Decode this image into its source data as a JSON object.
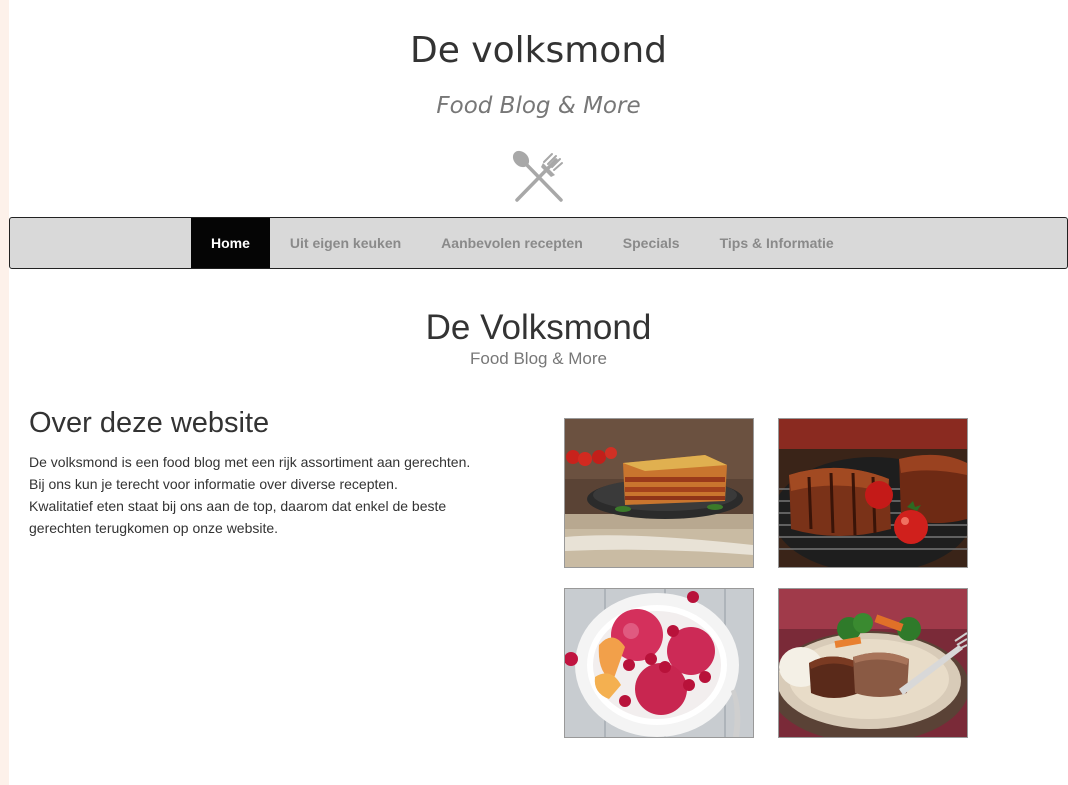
{
  "header": {
    "site_title": "De volksmond",
    "tagline": "Food Blog & More",
    "logo_icon": "cutlery-icon"
  },
  "nav": {
    "items": [
      {
        "label": "Home",
        "active": true
      },
      {
        "label": "Uit eigen keuken",
        "active": false
      },
      {
        "label": "Aanbevolen recepten",
        "active": false
      },
      {
        "label": "Specials",
        "active": false
      },
      {
        "label": "Tips & Informatie",
        "active": false
      }
    ],
    "active_bg": "#050505",
    "bar_bg": "#d9d9d9"
  },
  "hero": {
    "title": "De Volksmond",
    "subtitle": "Food Blog & More"
  },
  "about": {
    "title": "Over deze website",
    "lines": [
      "De volksmond is een food blog met een rijk assortiment aan gerechten.",
      "Bij ons kun je terecht voor informatie over diverse recepten.",
      "Kwalitatief eten staat bij ons aan de top, daarom dat enkel de beste",
      "gerechten terugkomen op onze website."
    ]
  },
  "gallery": {
    "images": [
      {
        "subject": "lasagna-photo"
      },
      {
        "subject": "grilled-ribs-photo"
      },
      {
        "subject": "raspberry-sorbet-photo"
      },
      {
        "subject": "steak-dinner-photo"
      }
    ]
  }
}
